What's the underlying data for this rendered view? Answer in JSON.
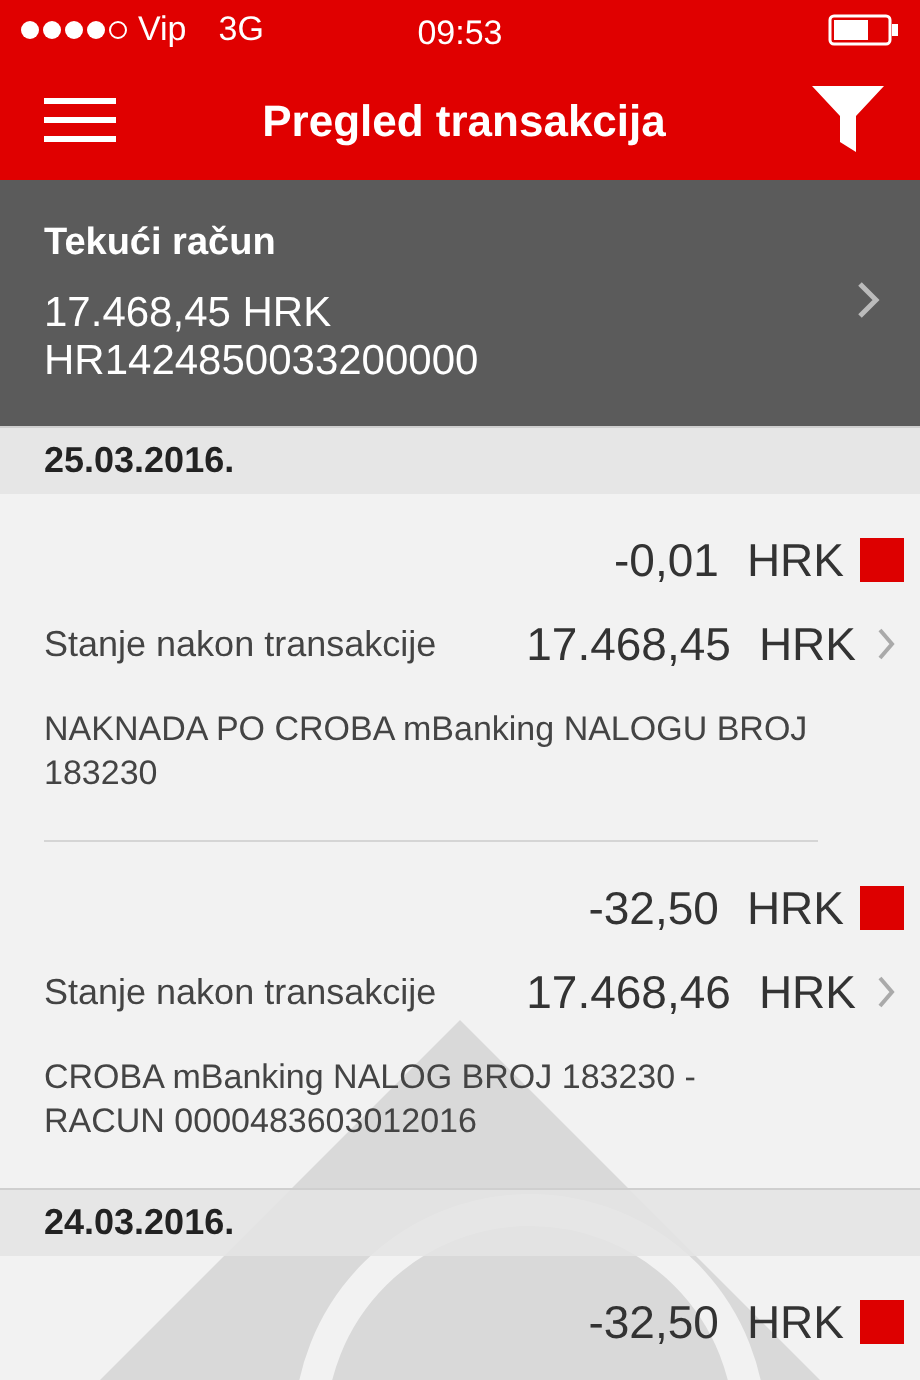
{
  "status_bar": {
    "carrier": "Vip",
    "network": "3G",
    "time": "09:53"
  },
  "header": {
    "title": "Pregled transakcija"
  },
  "account": {
    "name": "Tekući račun",
    "balance": "17.468,45 HRK",
    "iban": "HR1424850033200000"
  },
  "days": [
    {
      "date": "25.03.2016.",
      "transactions": [
        {
          "amount": "-0,01",
          "currency": "HRK",
          "color": "#dd0000",
          "balance_label": "Stanje nakon transakcije",
          "balance": "17.468,45",
          "balance_currency": "HRK",
          "description": "NAKNADA PO CROBA mBanking NALOGU BROJ 183230"
        },
        {
          "amount": "-32,50",
          "currency": "HRK",
          "color": "#dd0000",
          "balance_label": "Stanje nakon transakcije",
          "balance": "17.468,46",
          "balance_currency": "HRK",
          "description": "CROBA mBanking NALOG BROJ 183230 - RACUN 0000483603012016"
        }
      ]
    },
    {
      "date": "24.03.2016.",
      "transactions": [
        {
          "amount": "-32,50",
          "currency": "HRK",
          "color": "#dd0000"
        }
      ]
    }
  ]
}
